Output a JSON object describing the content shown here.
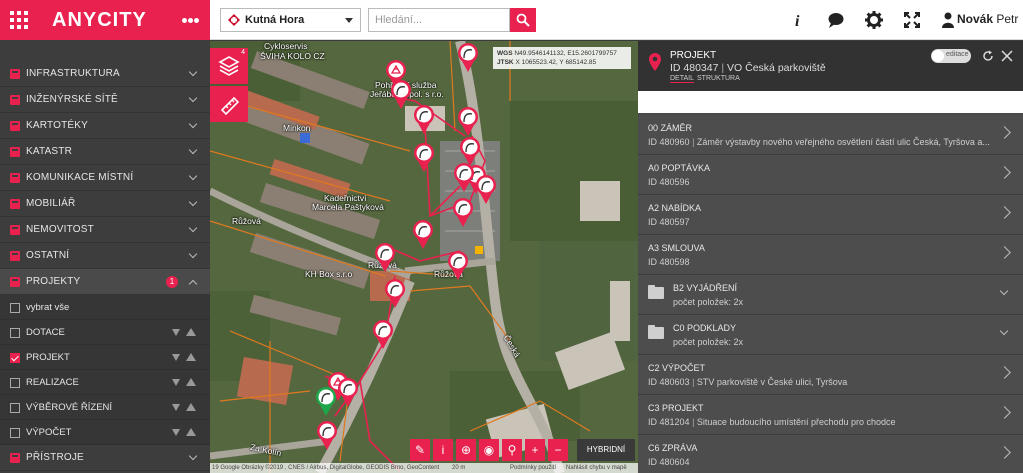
{
  "brand": {
    "logo": "ANYCITY"
  },
  "header": {
    "city": "Kutná Hora",
    "search_placeholder": "Hledání...",
    "user_first": "Novák",
    "user_last": "Petr"
  },
  "sidebar": {
    "items": [
      {
        "label": "INFRASTRUKTURA"
      },
      {
        "label": "INŽENÝRSKÉ SÍTĚ"
      },
      {
        "label": "KARTOTÉKY"
      },
      {
        "label": "KATASTR"
      },
      {
        "label": "KOMUNIKACE MÍSTNÍ"
      },
      {
        "label": "MOBILIÁŘ"
      },
      {
        "label": "NEMOVITOST"
      },
      {
        "label": "OSTATNÍ"
      },
      {
        "label": "PROJEKTY",
        "badge": "1"
      }
    ],
    "subitems": [
      {
        "label": "vybrat vše",
        "checked": false
      },
      {
        "label": "DOTACE",
        "checked": false
      },
      {
        "label": "PROJEKT",
        "checked": true
      },
      {
        "label": "REALIZACE",
        "checked": false
      },
      {
        "label": "VÝBĚROVÉ ŘÍZENÍ",
        "checked": false
      },
      {
        "label": "VÝPOČET",
        "checked": false
      }
    ],
    "last": {
      "label": "PŘÍSTROJE"
    }
  },
  "map": {
    "layers_count": "4",
    "wgs_label": "WGS",
    "wgs_value": "N49.9546141132, E15.2601799757",
    "jtsk_label": "JTSK",
    "jtsk_value": "X 1065523.42, Y 685142.85",
    "labels": [
      "Cykloservis",
      "ŠVIHA KOLO CZ",
      "Pohřební služba",
      "Jeřábek, spol. s r.o.",
      "Minkon",
      "Kadeřnictví",
      "Marcela Paštyková",
      "Růžová",
      "Růžová",
      "KH Box s.r.o",
      "Růžová",
      "Česká",
      "Za Kolín"
    ],
    "hybrid_label": "HYBRIDNÍ",
    "attribution": "19 Google Obrázky ©2019 , CNES / Airbus, DigitalGlobe, GEODIS Brno, GeoContent",
    "scale": "20 m",
    "terms": "Podmínky použití",
    "report": "Nahlásit chybu v mapě"
  },
  "panel": {
    "title": "PROJEKT",
    "id_line": "ID 480347",
    "name": "VO Česká parkoviště",
    "toggle_label": "editace",
    "tabs": [
      "DETAIL",
      "STRUKTURA"
    ],
    "rows": [
      {
        "l1": "00 ZÁMĚR",
        "id": "ID 480960",
        "desc": "Záměr výstavby nového veřejného osvětlení částí ulic Česká, Tyršova a...",
        "type": "link"
      },
      {
        "l1": "A0 POPTÁVKA",
        "id": "ID 480596",
        "desc": "",
        "type": "link"
      },
      {
        "l1": "A2 NABÍDKA",
        "id": "ID 480597",
        "desc": "",
        "type": "link"
      },
      {
        "l1": "A3 SMLOUVA",
        "id": "ID 480598",
        "desc": "",
        "type": "link"
      },
      {
        "l1": "B2 VYJÁDŘENÍ",
        "id": "počet položek: 2x",
        "desc": "",
        "type": "folder"
      },
      {
        "l1": "C0 PODKLADY",
        "id": "počet položek: 2x",
        "desc": "",
        "type": "folder"
      },
      {
        "l1": "C2 VÝPOČET",
        "id": "ID 480603",
        "desc": "STV parkoviště v České ulici, Tyršova",
        "type": "link"
      },
      {
        "l1": "C3 PROJEKT",
        "id": "ID 481204",
        "desc": "Situace budoucího umístění přechodu pro chodce",
        "type": "link"
      },
      {
        "l1": "C6 ZPRÁVA",
        "id": "ID 480604",
        "desc": "",
        "type": "link"
      }
    ]
  },
  "colors": {
    "accent": "#e8214f",
    "sidebar": "#3d3d3d",
    "panel": "#4d4d4d"
  }
}
